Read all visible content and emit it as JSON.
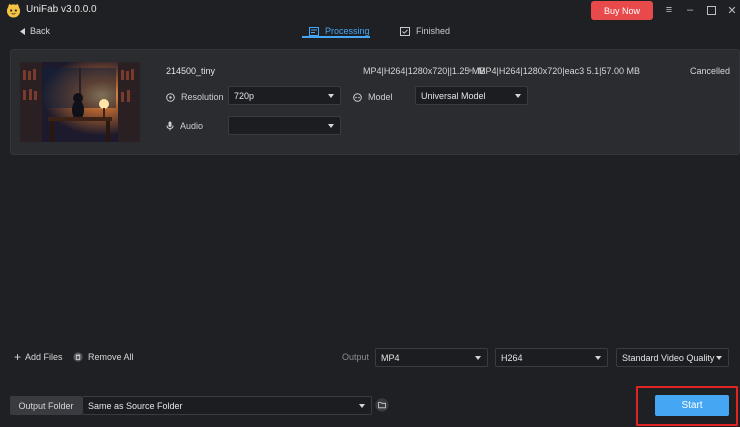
{
  "app": {
    "title": "UniFab v3.0.0.0",
    "buy_label": "Buy Now"
  },
  "nav": {
    "back_label": "Back",
    "tabs": [
      {
        "label": "Processing",
        "active": true
      },
      {
        "label": "Finished",
        "active": false
      }
    ]
  },
  "file": {
    "name": "214500_tiny",
    "source_info": "MP4|H264|1280x720||1.25 MB",
    "target_info": "MP4|H264|1280x720|eac3 5.1|57.00 MB",
    "status": "Cancelled",
    "resolution_label": "Resolution",
    "resolution_value": "720p",
    "model_label": "Model",
    "model_value": "Universal Model",
    "audio_label": "Audio",
    "audio_value": ""
  },
  "toolbar": {
    "add_files_label": "Add Files",
    "remove_all_label": "Remove All",
    "output_label": "Output",
    "format_value": "MP4",
    "codec_value": "H264",
    "quality_value": "Standard Video Quality"
  },
  "footer": {
    "output_folder_label": "Output Folder",
    "output_folder_value": "Same as Source Folder",
    "start_label": "Start"
  },
  "colors": {
    "accent": "#45a6f4",
    "buy": "#e84a4c",
    "highlight": "#e02424"
  }
}
